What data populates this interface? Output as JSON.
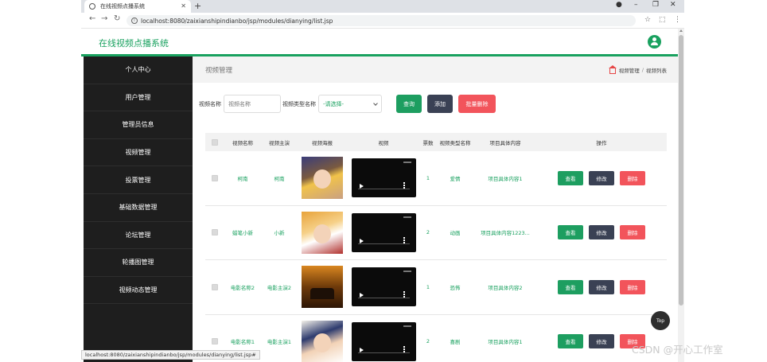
{
  "browser": {
    "tab_title": "在线视频点播系统",
    "url": "localhost:8080/zaixianshipindianbo/jsp/modules/dianying/list.jsp",
    "status_url": "localhost:8080/zaixianshipindianbo/jsp/modules/dianying/list.jsp#"
  },
  "app": {
    "title": "在线视频点播系统",
    "accent": "#19a15f"
  },
  "sidebar": {
    "items": [
      {
        "label": "个人中心"
      },
      {
        "label": "用户管理"
      },
      {
        "label": "管理员信息"
      },
      {
        "label": "视频管理"
      },
      {
        "label": "投票管理"
      },
      {
        "label": "基础数据管理"
      },
      {
        "label": "论坛管理"
      },
      {
        "label": "轮播图管理"
      },
      {
        "label": "视频动态管理"
      }
    ]
  },
  "page": {
    "title": "视频管理",
    "breadcrumb": [
      "视频管理",
      "视频列表"
    ],
    "separator": "/"
  },
  "search": {
    "name_label": "视频名称",
    "name_placeholder": "视频名称",
    "type_label": "视频类型名称",
    "type_selected": "-请选择-",
    "query_label": "查询",
    "add_label": "添加",
    "batch_delete_label": "批量删除"
  },
  "table": {
    "headers": {
      "name": "视频名称",
      "star": "视频主演",
      "poster": "视频海报",
      "video": "视频",
      "votes": "票数",
      "type": "视频类型名称",
      "content": "项目具体内容",
      "ops": "操作"
    },
    "rows": [
      {
        "name": "柯南",
        "star": "柯南",
        "votes": "1",
        "type": "爱情",
        "content": "项目具体内容1"
      },
      {
        "name": "蜡笔小新",
        "star": "小新",
        "votes": "2",
        "type": "动画",
        "content": "项目具体内容1223..."
      },
      {
        "name": "电影名称2",
        "star": "电影主演2",
        "votes": "1",
        "type": "恐怖",
        "content": "项目具体内容2"
      },
      {
        "name": "电影名称1",
        "star": "电影主演1",
        "votes": "2",
        "type": "喜剧",
        "content": "项目具体内容1"
      }
    ],
    "op_view": "查看",
    "op_edit": "修改",
    "op_delete": "删除"
  },
  "top_button": "Top",
  "watermark": "CSDN @开心工作室"
}
